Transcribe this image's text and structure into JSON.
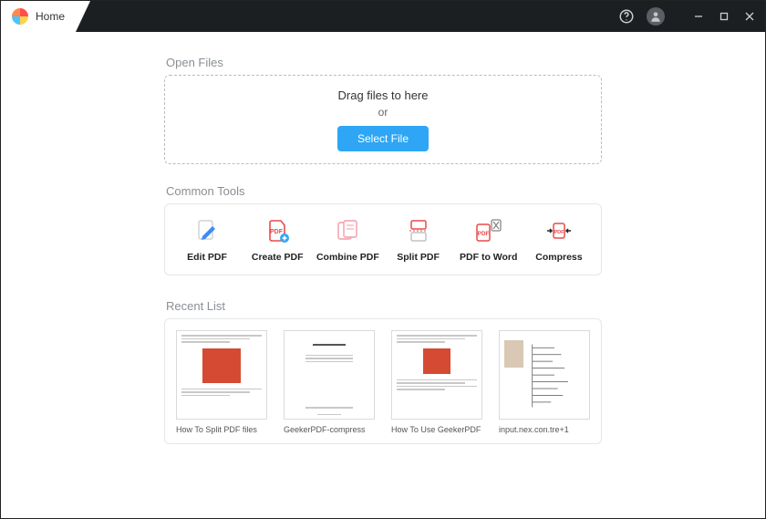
{
  "titlebar": {
    "tab_label": "Home"
  },
  "open_files": {
    "title": "Open Files",
    "drag_text": "Drag files to here",
    "or_text": "or",
    "button_label": "Select File"
  },
  "common_tools": {
    "title": "Common Tools",
    "items": [
      {
        "label": "Edit PDF",
        "icon": "edit-pdf-icon"
      },
      {
        "label": "Create PDF",
        "icon": "create-pdf-icon"
      },
      {
        "label": "Combine PDF",
        "icon": "combine-pdf-icon"
      },
      {
        "label": "Split PDF",
        "icon": "split-pdf-icon"
      },
      {
        "label": "PDF to Word",
        "icon": "pdf-to-word-icon"
      },
      {
        "label": "Compress",
        "icon": "compress-icon"
      }
    ]
  },
  "recent_list": {
    "title": "Recent List",
    "items": [
      {
        "name": "How To Split PDF files"
      },
      {
        "name": "GeekerPDF-compress"
      },
      {
        "name": "How To Use GeekerPDF"
      },
      {
        "name": "input.nex.con.tre+1"
      }
    ]
  }
}
